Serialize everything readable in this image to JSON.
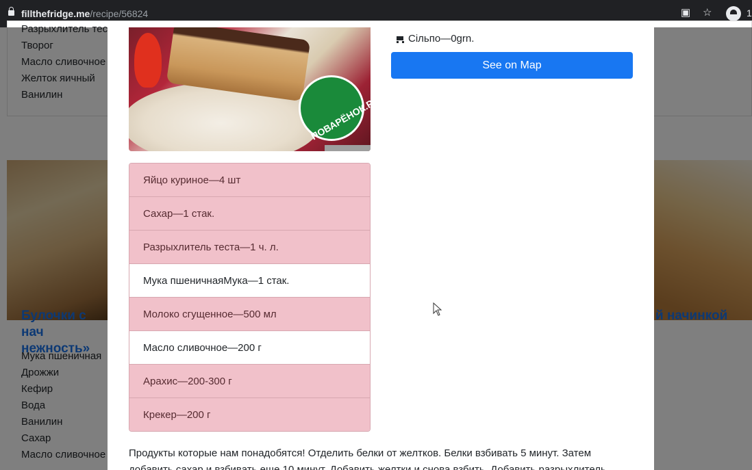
{
  "browser": {
    "url_host": "fillthefridge.me",
    "url_path": "/recipe/56824",
    "profile_count": "1"
  },
  "background": {
    "card1_items": [
      "Разрыхлитель тес",
      "Творог",
      "Масло сливочное",
      "Желток яичный",
      "Ванилин"
    ],
    "card2_title": "Булочки с нач нежность»",
    "card2_items": [
      "Мука пшеничная",
      "Дрожжи",
      "Кефир",
      "Вода",
      "Ванилин",
      "Сахар",
      "Масло сливочное"
    ],
    "card3_title": "й начинкой"
  },
  "modal": {
    "photo_logo": "ПОВАРЁНОК.РУ",
    "shop_label": "Сільпо—0grn.",
    "map_button": "See on Map",
    "ingredients": [
      {
        "text": "Яйцо куриное—4 шт",
        "available": false
      },
      {
        "text": "Сахар—1 стак.",
        "available": false
      },
      {
        "text": "Разрыхлитель теста—1 ч. л.",
        "available": false
      },
      {
        "text": "Мука пшеничнаяМука—1 стак.",
        "available": true
      },
      {
        "text": "Молоко сгущенное—500 мл",
        "available": false
      },
      {
        "text": "Масло сливочное—200 г",
        "available": true
      },
      {
        "text": "Арахис—200-300 г",
        "available": false
      },
      {
        "text": "Крекер—200 г",
        "available": false
      }
    ],
    "description": "Продукты которые нам понадобятся! Отделить белки от желтков. Белки взбивать 5 минут. Затем добавить сахар и взбивать еще 10 минут. Добавить желтки и снова взбить. Добавить разрыхлитель"
  },
  "colors": {
    "accent": "#1877f2",
    "missing_ingredient": "#f1c1ca",
    "link": "#1a73e8"
  }
}
